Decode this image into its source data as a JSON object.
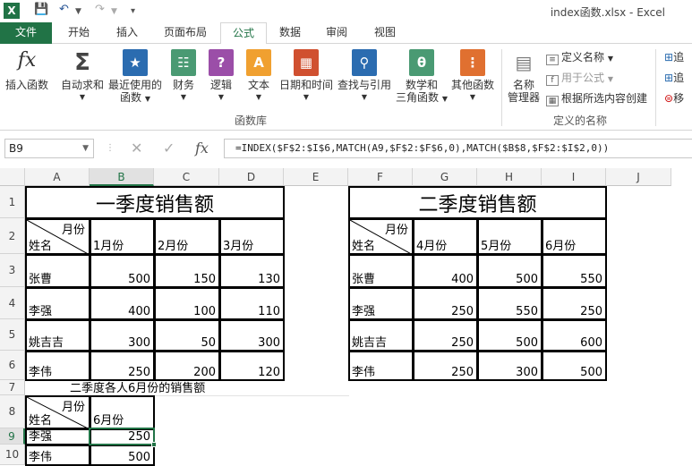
{
  "window": {
    "title": "index函数.xlsx - Excel",
    "logo_text": "X",
    "save_icon": "save-icon",
    "undo_icon": "undo-icon",
    "redo_icon": "redo-icon"
  },
  "tabs": {
    "file": "文件",
    "home": "开始",
    "insert": "插入",
    "layout": "页面布局",
    "formulas": "公式",
    "data": "数据",
    "review": "审阅",
    "view": "视图"
  },
  "ribbon": {
    "insert_function": "插入函数",
    "autosum": "自动求和",
    "recent_1": "最近使用的",
    "recent_2": "函数",
    "financial": "财务",
    "logical": "逻辑",
    "text": "文本",
    "datetime": "日期和时间",
    "lookup": "查找与引用",
    "math_1": "数学和",
    "math_2": "三角函数",
    "more": "其他函数",
    "group_library": "函数库",
    "name_manager_1": "名称",
    "name_manager_2": "管理器",
    "define_name": "定义名称",
    "use_in_formula": "用于公式",
    "create_from_selection": "根据所选内容创建",
    "group_names": "定义的名称",
    "trace_1": "追",
    "trace_2": "追",
    "remove": "移"
  },
  "formula_bar": {
    "name_box": "B9",
    "cancel_icon": "✕",
    "enter_icon": "✓",
    "fx": "fx",
    "formula": "=INDEX($F$2:$I$6,MATCH(A9,$F$2:$F$6,0),MATCH($B$8,$F$2:$I$2,0))"
  },
  "grid": {
    "columns": [
      "A",
      "B",
      "C",
      "D",
      "E",
      "F",
      "G",
      "H",
      "I",
      "J"
    ],
    "rows": [
      "1",
      "2",
      "3",
      "4",
      "5",
      "6",
      "7",
      "8",
      "9",
      "10"
    ],
    "table1": {
      "title": "一季度销售额",
      "header_month": "月份",
      "header_name": "姓名",
      "months": [
        "1月份",
        "2月份",
        "3月份"
      ],
      "names": [
        "张曹",
        "李强",
        "姚吉吉",
        "李伟"
      ],
      "values": [
        [
          "500",
          "150",
          "130"
        ],
        [
          "400",
          "100",
          "110"
        ],
        [
          "300",
          "50",
          "300"
        ],
        [
          "250",
          "200",
          "120"
        ]
      ]
    },
    "table2": {
      "title": "二季度销售额",
      "header_month": "月份",
      "header_name": "姓名",
      "months": [
        "4月份",
        "5月份",
        "6月份"
      ],
      "names": [
        "张曹",
        "李强",
        "姚吉吉",
        "李伟"
      ],
      "values": [
        [
          "400",
          "500",
          "550"
        ],
        [
          "250",
          "550",
          "250"
        ],
        [
          "250",
          "500",
          "600"
        ],
        [
          "250",
          "300",
          "500"
        ]
      ]
    },
    "note": "二季度各人6月份的销售额",
    "table3": {
      "header_month": "月份",
      "header_name": "姓名",
      "month": "6月份",
      "names": [
        "李强",
        "李伟"
      ],
      "values": [
        "250",
        "500"
      ]
    }
  }
}
